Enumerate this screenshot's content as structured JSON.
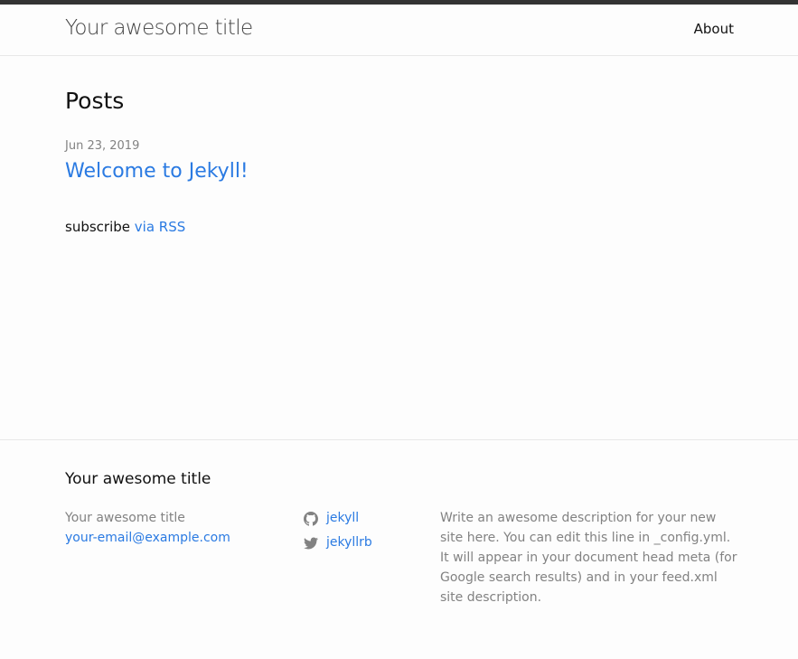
{
  "header": {
    "site_title": "Your awesome title",
    "nav": [
      {
        "label": "About"
      }
    ]
  },
  "main": {
    "heading": "Posts",
    "posts": [
      {
        "date": "Jun 23, 2019",
        "title": "Welcome to Jekyll!"
      }
    ],
    "rss": {
      "prefix": "subscribe",
      "link_label": "via RSS"
    }
  },
  "footer": {
    "heading": "Your awesome title",
    "site_name": "Your awesome title",
    "email": "your-email@example.com",
    "social": [
      {
        "icon": "github-icon",
        "label": "jekyll"
      },
      {
        "icon": "twitter-icon",
        "label": "jekyllrb"
      }
    ],
    "description": "Write an awesome description for your new site here. You can edit this line in _config.yml. It will appear in your document head meta (for Google search results) and in your feed.xml site description."
  },
  "colors": {
    "link": "#2a7ae2",
    "meta_grey": "#828282",
    "header_border": "#333333"
  }
}
